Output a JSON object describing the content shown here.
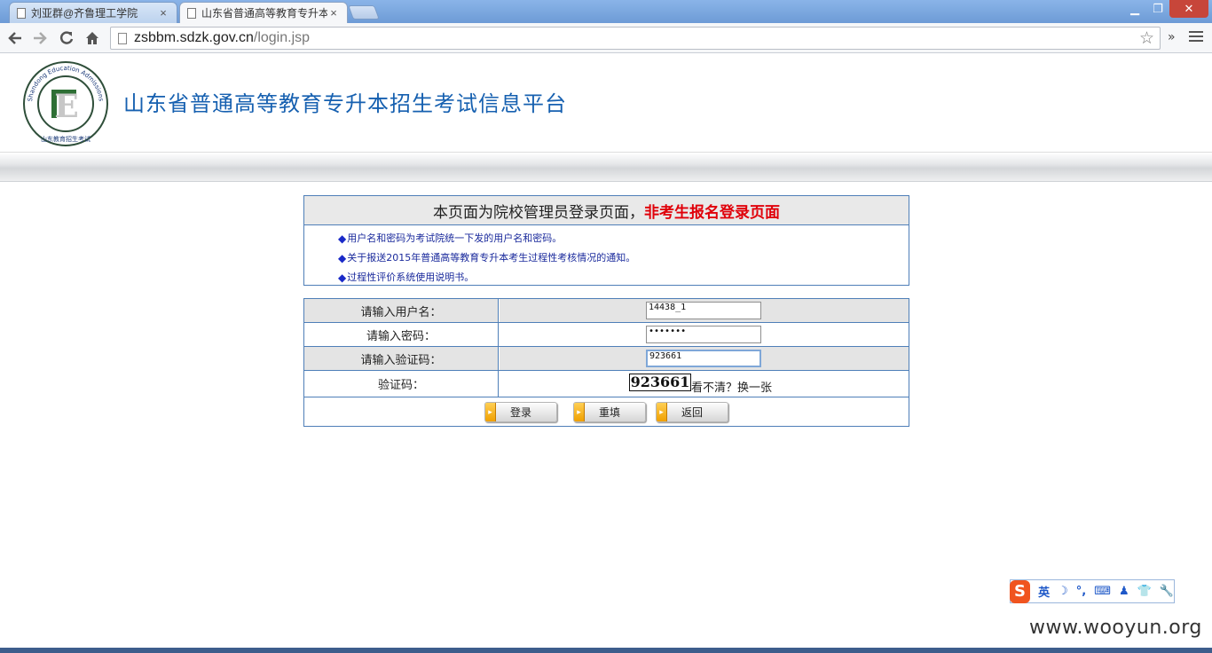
{
  "browser": {
    "tabs": [
      {
        "title": "刘亚群@齐鲁理工学院",
        "close": "×"
      },
      {
        "title": "山东省普通高等教育专升本",
        "close": "×"
      }
    ],
    "window_controls": {
      "minimize": "▁",
      "maximize": "❐",
      "close": "✕"
    },
    "address": {
      "host": "zsbbm.sdzk.gov.cn",
      "path": "/login.jsp"
    }
  },
  "header": {
    "title": "山东省普通高等教育专升本招生考试信息平台",
    "logo_ring_text": "Shandong Education Admissions & Examinations",
    "logo_bottom_text": "山东教育招生考试",
    "logo_letter": "E"
  },
  "notice": {
    "heading": "本页面为院校管理员登录页面，",
    "heading_warning": "非考生报名登录页面",
    "bullet": "◆",
    "items": [
      "用户名和密码为考试院统一下发的用户名和密码。",
      "关于报送2015年普通高等教育专升本考生过程性考核情况的通知。",
      "过程性评价系统使用说明书。"
    ]
  },
  "login": {
    "username_label": "请输入用户名：",
    "username_value": "14438_1",
    "password_label": "请输入密码：",
    "password_value": "•••••••",
    "captcha_input_label": "请输入验证码：",
    "captcha_input_value": "923661",
    "captcha_label": "验证码：",
    "captcha_image_text": "923661",
    "captcha_refresh": "看不清？换一张",
    "buttons": {
      "login": "登录",
      "reset": "重填",
      "back": "返回"
    }
  },
  "ime": {
    "logo": "S",
    "mode": "英",
    "icons": [
      "☽",
      "°,",
      "⌨",
      "♟",
      "👕",
      "🔧"
    ]
  },
  "watermark": "www.wooyun.org",
  "colors": {
    "title_blue": "#1660b0",
    "warning_red": "#e0000a",
    "border_blue": "#4f7fb8",
    "notice_text": "#1a2a9c"
  }
}
